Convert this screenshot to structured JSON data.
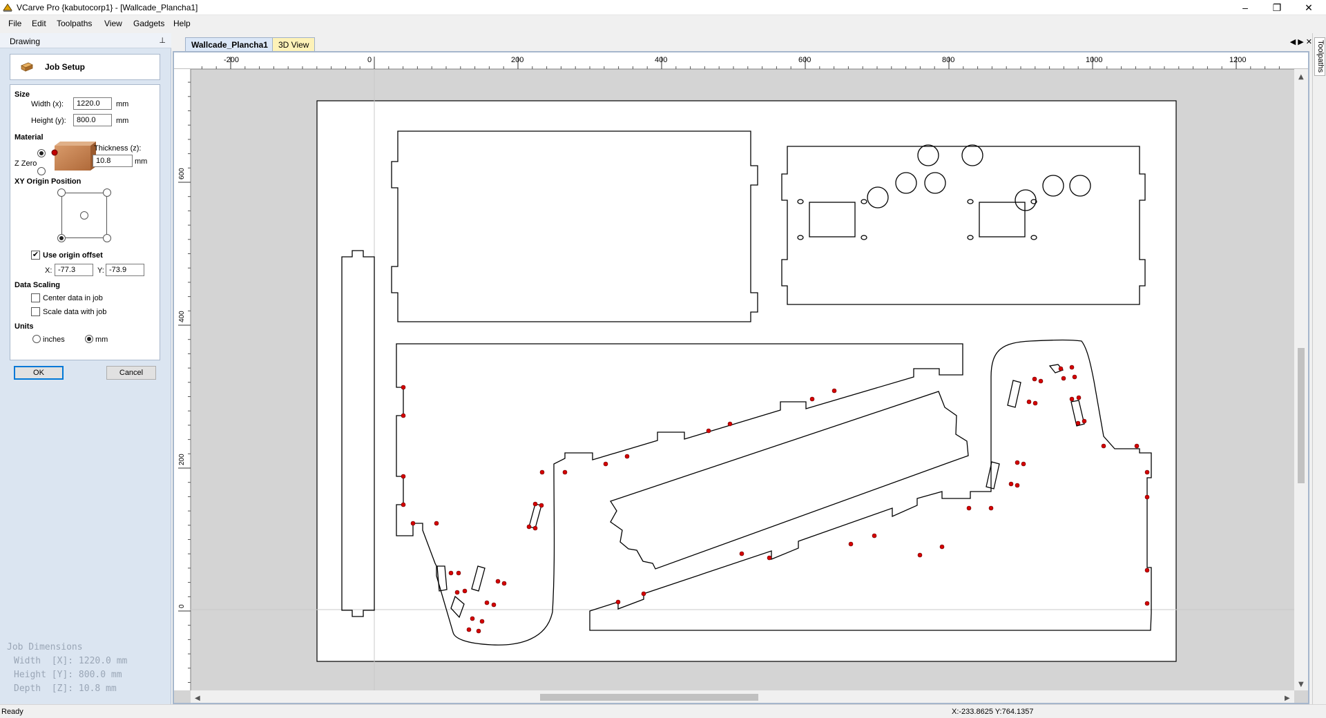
{
  "app": {
    "title": "VCarve Pro {kabutocorp1} - [Wallcade_Plancha1]",
    "window_controls": {
      "minimize": "–",
      "maximize": "❐",
      "close": "✕"
    }
  },
  "menu": {
    "items": [
      "File",
      "Edit",
      "Toolpaths",
      "View",
      "Gadgets",
      "Help"
    ]
  },
  "panel": {
    "title": "Drawing",
    "pin": "⊥",
    "job_setup_title": "Job Setup",
    "size_heading": "Size",
    "width_label": "Width (x):",
    "width_value": "1220.0",
    "width_unit": "mm",
    "height_label": "Height (y):",
    "height_value": "800.0",
    "height_unit": "mm",
    "material_heading": "Material",
    "z_zero_label": "Z Zero",
    "thickness_label": "Thickness (z):",
    "thickness_value": "10.8",
    "thickness_unit": "mm",
    "xy_origin_heading": "XY Origin Position",
    "use_origin_offset_label": "Use origin offset",
    "use_origin_offset_checked": true,
    "offset_x_label": "X:",
    "offset_x_value": "-77.3",
    "offset_y_label": "Y:",
    "offset_y_value": "-73.9",
    "data_scaling_heading": "Data Scaling",
    "center_data_label": "Center data in job",
    "scale_data_label": "Scale data with job",
    "units_heading": "Units",
    "unit_inches_label": "inches",
    "unit_mm_label": "mm",
    "selected_unit": "mm",
    "ok_label": "OK",
    "cancel_label": "Cancel",
    "job_dimensions": {
      "heading": "Job Dimensions",
      "width": "Width  [X]: 1220.0 mm",
      "height": "Height [Y]: 800.0 mm",
      "depth": "Depth  [Z]: 10.8 mm"
    }
  },
  "tabs": {
    "items": [
      "Wallcade_Plancha1",
      "3D View"
    ],
    "active": "Wallcade_Plancha1",
    "nav": "◀ ▶ ✕"
  },
  "right_panel": {
    "toolpaths_tab": "Toolpaths"
  },
  "rulers": {
    "horizontal_ticks": [
      "-200",
      "0",
      "200",
      "400",
      "600",
      "800",
      "1000",
      "1200"
    ],
    "vertical_ticks": [
      "600",
      "400",
      "200",
      "0"
    ]
  },
  "status": {
    "left": "Ready",
    "coords": "X:-233.8625 Y:764.1357"
  },
  "colors": {
    "panel_bg": "#dbe5f1",
    "canvas_bg": "#d4d4d4",
    "sheet": "#ffffff",
    "vector": "#000000",
    "node": "#d40000",
    "tab_active": "#dbe7f7",
    "tab_3d": "#fdf2b8"
  }
}
